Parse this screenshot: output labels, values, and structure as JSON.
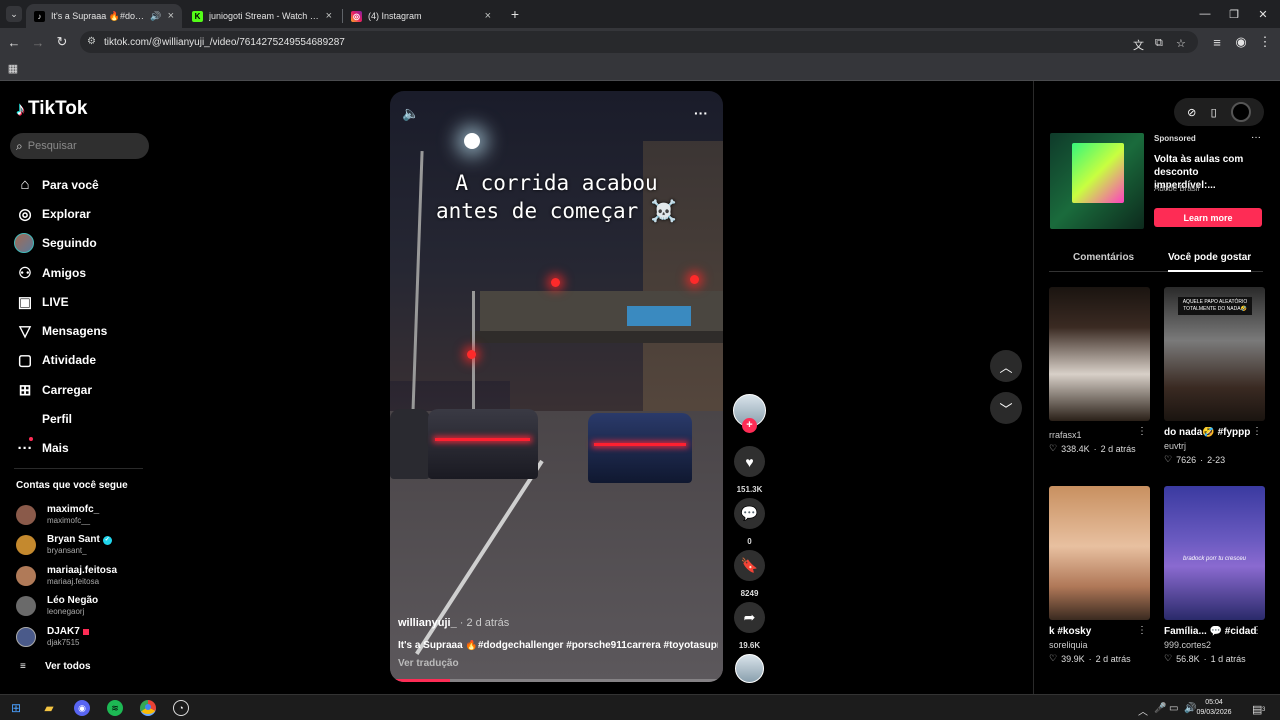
{
  "browser": {
    "tabs": [
      {
        "title": "It's a Supraaa 🔥#dodgech",
        "active": true
      },
      {
        "title": "juniogoti Stream - Watch Live o",
        "active": false
      },
      {
        "title": "(4) Instagram",
        "active": false
      }
    ],
    "url": "tiktok.com/@willianyuji_/video/7614275249554689287"
  },
  "sidebar": {
    "logo": "TikTok",
    "search_placeholder": "Pesquisar",
    "nav": [
      {
        "label": "Para você",
        "icon": "home-icon"
      },
      {
        "label": "Explorar",
        "icon": "compass-icon"
      },
      {
        "label": "Seguindo",
        "icon": "avatar"
      },
      {
        "label": "Amigos",
        "icon": "friends-icon"
      },
      {
        "label": "LIVE",
        "icon": "live-icon"
      },
      {
        "label": "Mensagens",
        "icon": "send-icon"
      },
      {
        "label": "Atividade",
        "icon": "activity-icon"
      },
      {
        "label": "Carregar",
        "icon": "upload-icon"
      },
      {
        "label": "Perfil",
        "icon": ""
      },
      {
        "label": "Mais",
        "icon": "more-icon"
      }
    ],
    "following_title": "Contas que você segue",
    "accounts": [
      {
        "name": "maximofc_",
        "handle": "maximofc__",
        "color": "#8a5a4a"
      },
      {
        "name": "Bryan Sant",
        "handle": "bryansant_",
        "color": "#c4892e",
        "verified": true
      },
      {
        "name": "mariaaj.feitosa",
        "handle": "mariaaj.feitosa",
        "color": "#b07a58"
      },
      {
        "name": "Léo Negão",
        "handle": "leonegaorj",
        "color": "#6a6a6a"
      },
      {
        "name": "DJAK7",
        "handle": "djak7515",
        "color": "#4a5a8a"
      }
    ],
    "see_all": "Ver todos"
  },
  "video": {
    "caption_line1": "A corrida acabou",
    "caption_line2": "antes de começar ☠️",
    "author": "willianyuji_",
    "date": " · 2 d atrás",
    "description": "It's a Supraaa 🔥#dodgechallenger #porsche911carrera #toyotasupra",
    "translate": "Ver tradução",
    "progress": 0.18
  },
  "actions": {
    "likes": "151.3K",
    "comments": "0",
    "saves": "8249",
    "shares": "19.6K"
  },
  "ad": {
    "sponsored": "Sponsored",
    "title": "Volta às aulas com desconto imperdível:...",
    "brand": "Adobe Brasil",
    "cta": "Learn more"
  },
  "right_tabs": {
    "comments": "Comentários",
    "may_like": "Você pode gostar"
  },
  "cards": [
    {
      "title": "",
      "user": "rrafasx1",
      "likes": "338.4K",
      "date": "2 d atrás",
      "bg": "linear-gradient(180deg,#1a1410,#4a3a30 50%,#e8e2dc 80%,#2a2018)"
    },
    {
      "title": "do nada🤣 #fyppp",
      "user": "euvtrj",
      "likes": "7626",
      "date": "2-23",
      "bg": "linear-gradient(180deg,#1a1a1a,#6a6a6a 40%,#3a2a22 70%,#1a1410)",
      "overlay": "AQUELE PAPO ALEATÓRIO TOTALMENTE DO NADA🤣"
    },
    {
      "title": "k #kosky",
      "user": "soreliquia",
      "likes": "39.9K",
      "date": "2 d atrás",
      "bg": "linear-gradient(180deg,#d8a070,#e8c0a0 40%,#c08868 70%,#3a2a20)"
    },
    {
      "title": "Família... 💬 #cidadededeus...",
      "user": "999.cortes2",
      "likes": "56.8K",
      "date": "1 d atrás",
      "bg": "linear-gradient(180deg,#3a3aa0,#6a5ac0 40%,#8a6ad0 60%,#2a2a6a)",
      "overlay": "bradock porr tu cresceu"
    }
  ],
  "taskbar": {
    "time": "05:04",
    "date": "09/03/2026",
    "notifications": "3"
  }
}
